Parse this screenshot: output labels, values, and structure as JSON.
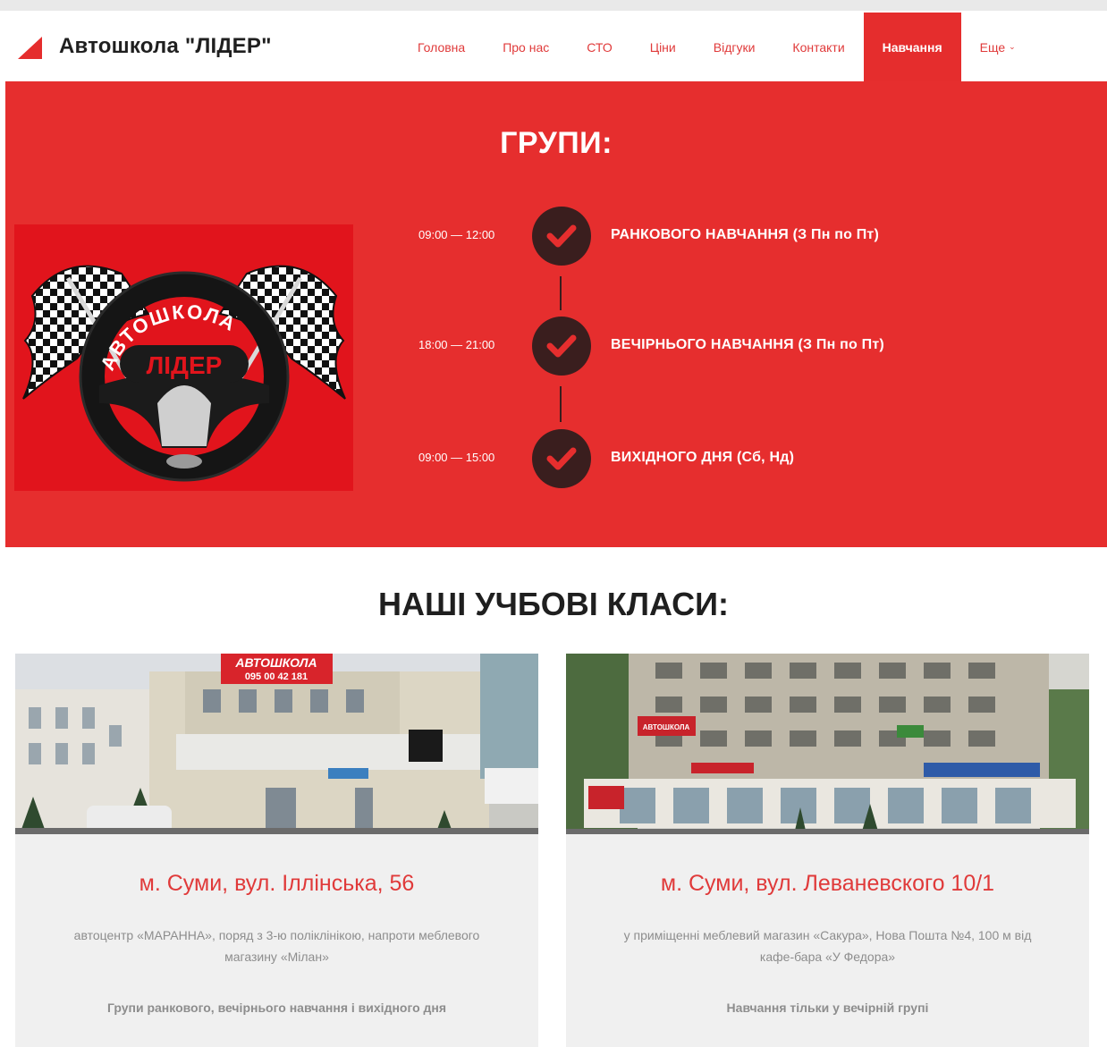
{
  "header": {
    "brand": "Автошкола \"ЛІДЕР\"",
    "nav": [
      {
        "label": "Головна"
      },
      {
        "label": "Про нас"
      },
      {
        "label": "СТО"
      },
      {
        "label": "Ціни"
      },
      {
        "label": "Відгуки"
      },
      {
        "label": "Контакти"
      },
      {
        "label": "Навчання",
        "active": true
      },
      {
        "label": "Еще"
      }
    ],
    "accent_color": "#e52d2d"
  },
  "groups": {
    "title": "ГРУПИ:",
    "logo_image": {
      "text_top": "АВТОШКОЛА",
      "text_main": "ЛІДЕР"
    },
    "items": [
      {
        "time": "09:00 — 12:00",
        "label": "РАНКОВОГО НАВЧАННЯ (З Пн по Пт)",
        "icon": "check-icon"
      },
      {
        "time": "18:00 — 21:00",
        "label": "ВЕЧІРНЬОГО НАВЧАННЯ (З Пн по Пт)",
        "icon": "check-icon"
      },
      {
        "time": "09:00 — 15:00",
        "label": "ВИХІДНОГО ДНЯ (Сб, Нд)",
        "icon": "check-icon"
      }
    ]
  },
  "classes": {
    "title": "НАШІ УЧБОВІ КЛАСИ:",
    "cards": [
      {
        "photo_sign": "АВТОШКОЛА",
        "photo_phone": "095 00 42 181",
        "address": "м. Суми, вул. Іллінська, 56",
        "description": "автоцентр «МАРАННА», поряд з 3-ю поліклінікою, напроти меблевого магазину «Мілан»",
        "note": "Групи ранкового, вечірнього навчання і вихідного дня"
      },
      {
        "photo_sign": "АВТОШКОЛА",
        "address": "м. Суми, вул. Леваневского 10/1",
        "description": "у приміщенні меблевий магазин «Сакура», Нова Пошта №4, 100 м від кафе-бара «У Федора»",
        "note": "Навчання тільки у вечірній групі"
      }
    ]
  }
}
